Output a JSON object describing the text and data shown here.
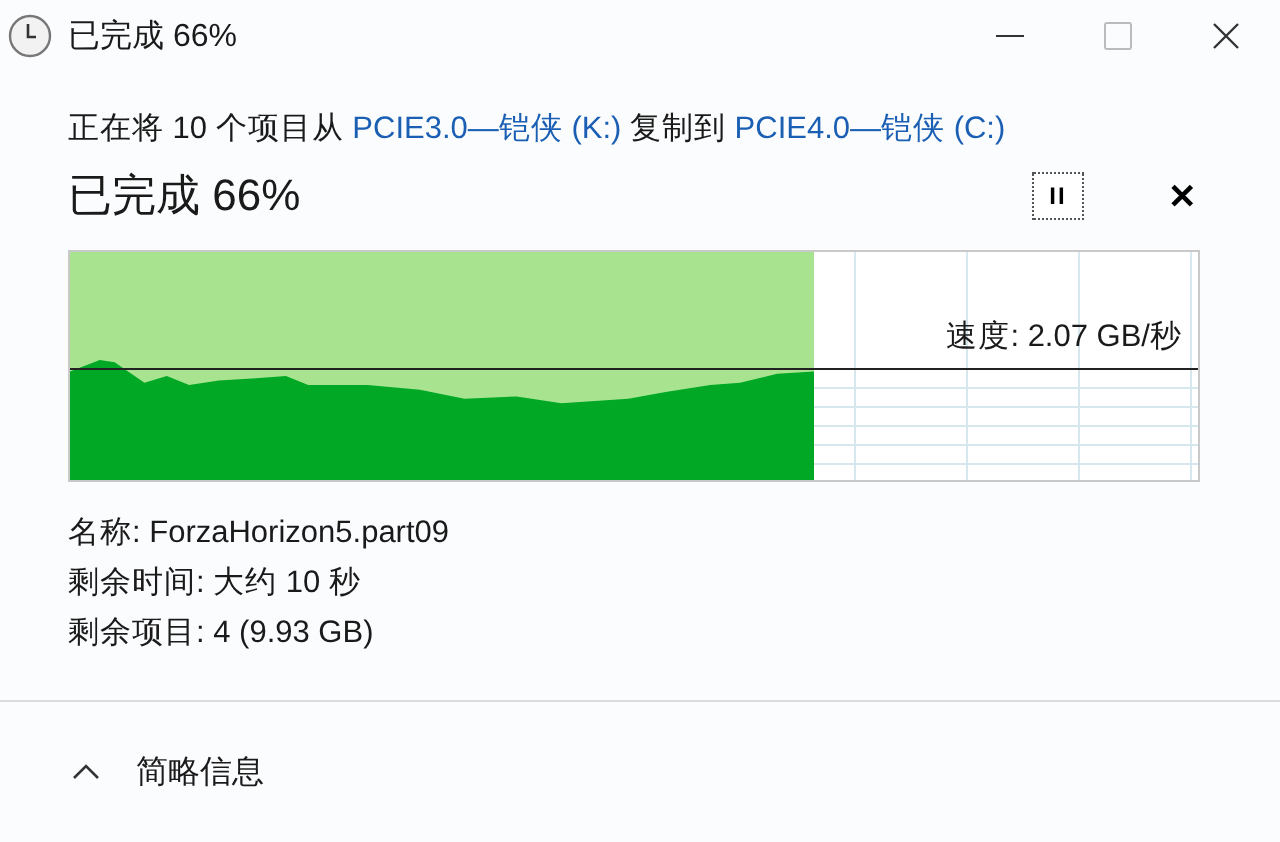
{
  "window": {
    "title": "已完成 66%"
  },
  "description": [
    {
      "kind": "text",
      "text": "正在将 10 个项目从 "
    },
    {
      "kind": "link",
      "text": "PCIE3.0—铠侠 (K:)"
    },
    {
      "kind": "text",
      "text": " 复制到 "
    },
    {
      "kind": "link",
      "text": "PCIE4.0—铠侠 (C:)"
    }
  ],
  "heading": "已完成 66%",
  "pause_button": {
    "label": "II"
  },
  "cancel_button": {
    "label": "✕"
  },
  "progress": {
    "level": 0.66,
    "speed": "速度: 2.07 GB/秒"
  },
  "details": [
    "名称: ForzaHorizon5.part09",
    "剩余时间: 大约 10 秒",
    "剩余项目: 4 (9.93 GB)"
  ],
  "footer": {
    "label": "简略信息",
    "expanded": true
  }
}
